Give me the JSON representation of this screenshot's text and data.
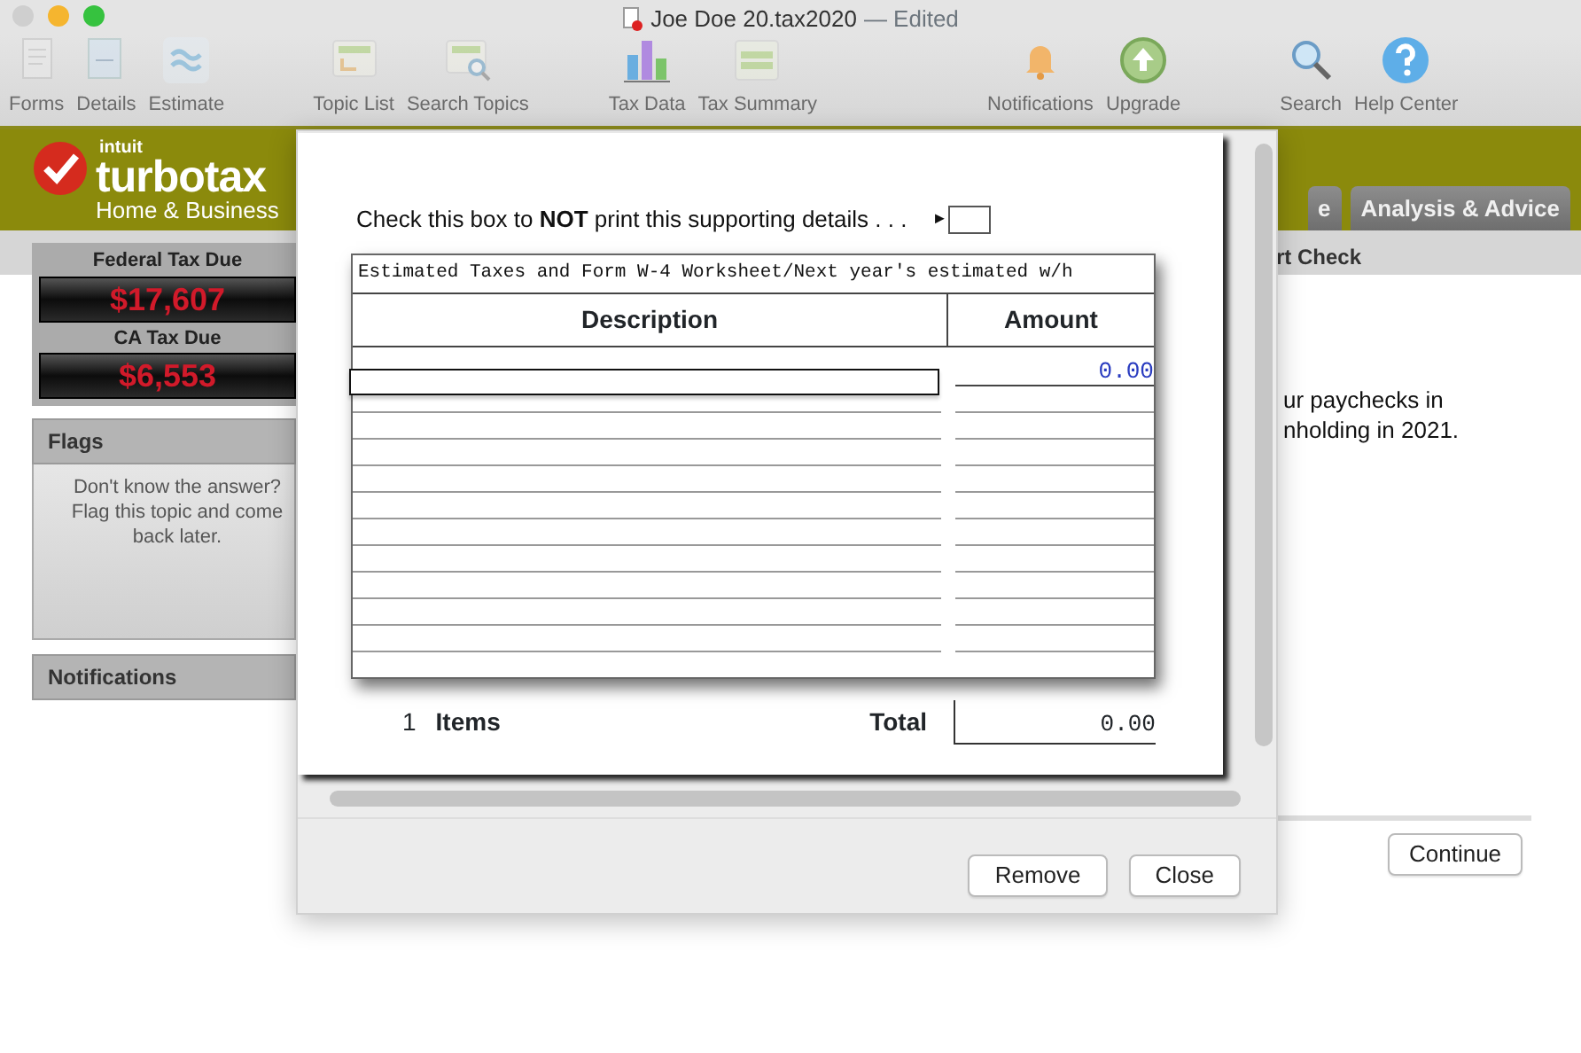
{
  "window": {
    "title": "Joe Doe 20.tax2020",
    "status": "— Edited"
  },
  "toolbar": [
    {
      "items": [
        {
          "label": "Forms",
          "disabled": true
        },
        {
          "label": "Details",
          "disabled": true
        },
        {
          "label": "Estimate",
          "disabled": true
        }
      ]
    },
    {
      "items": [
        {
          "label": "Topic List",
          "disabled": true
        },
        {
          "label": "Search Topics",
          "disabled": true
        }
      ]
    },
    {
      "items": [
        {
          "label": "Tax Data",
          "disabled": false
        },
        {
          "label": "Tax Summary",
          "disabled": true
        }
      ]
    },
    {
      "items": [
        {
          "label": "Notifications",
          "disabled": false
        },
        {
          "label": "Upgrade",
          "disabled": false
        }
      ]
    },
    {
      "items": [
        {
          "label": "Search",
          "disabled": false
        },
        {
          "label": "Help Center",
          "disabled": false
        }
      ]
    }
  ],
  "logo": {
    "brand": "intuit",
    "product": "turbotax",
    "edition": "Home & Business"
  },
  "tabs": [
    {
      "label": "e",
      "selected": false
    },
    {
      "label": "Analysis & Advice",
      "selected": false
    }
  ],
  "subtab": "rt Check",
  "sidebar": {
    "tax_due": [
      {
        "label": "Federal Tax Due",
        "amount": "$17,607"
      },
      {
        "label": "CA Tax Due",
        "amount": "$6,553"
      }
    ],
    "flags": {
      "title": "Flags",
      "text": "Don't know the answer? Flag this topic and come back later."
    },
    "notifications": {
      "title": "Notifications"
    }
  },
  "main": {
    "lines": [
      "ur paychecks in",
      "nholding in 2021."
    ],
    "button": "Continue"
  },
  "dialog": {
    "checkbox": {
      "label": "Check this box to **NOT** print this supporting details . . .",
      "marker": "►",
      "checked": false
    },
    "worksheet": {
      "title": "Estimated Taxes and Form W-4 Worksheet/Next year's estimated w/h",
      "columns": [
        "Description",
        "Amount"
      ],
      "rows": [
        {
          "amount": "0.00",
          "selected": true
        }
      ]
    },
    "items_count": "1",
    "items_label": "Items",
    "total_label": "Total",
    "total": "0.00",
    "buttons": [
      "Remove",
      "Close"
    ]
  }
}
